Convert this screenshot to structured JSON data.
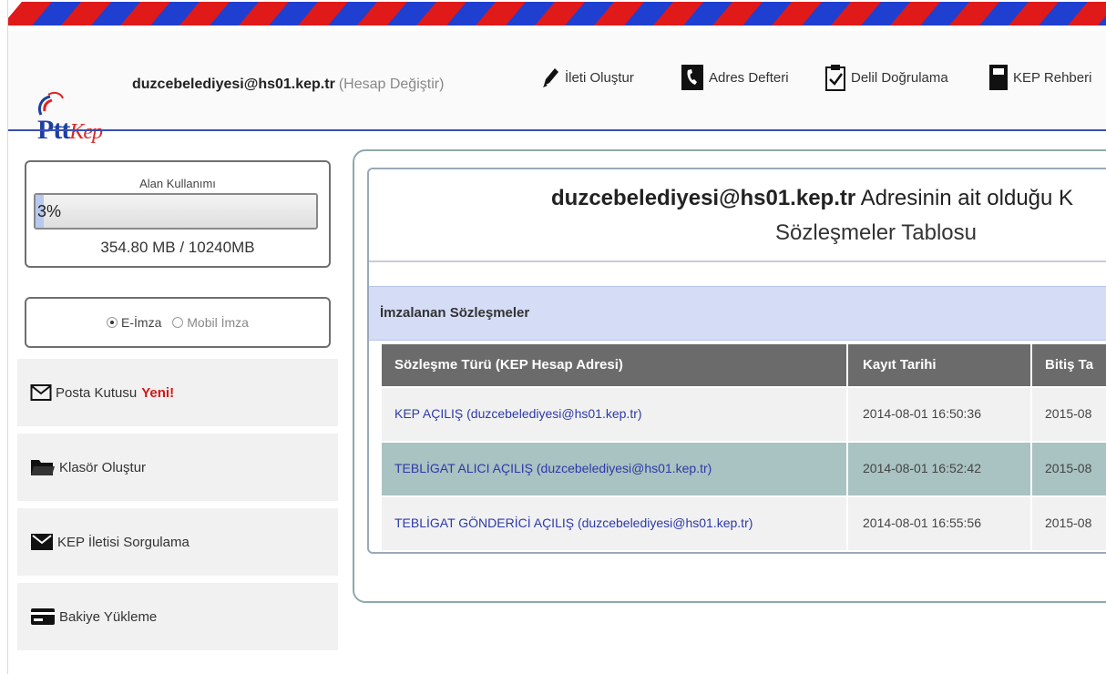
{
  "colors": {
    "stripe_red": "#e01919",
    "stripe_blue": "#1f3fd0",
    "link_blue": "#2d3aa8",
    "accent_new": "#d01818",
    "header_line": "#3a4fb4",
    "section_bg": "#d4dcf6",
    "table_head": "#6b6b6b",
    "row_alt": "#a9c2c2",
    "row_light": "#f1f1f1"
  },
  "header": {
    "logo": {
      "text_main": "Ptt",
      "text_sub": "Kep"
    },
    "account": {
      "email": "duzcebelediyesi@hs01.kep.tr",
      "change_label": "(Hesap Değiştir)"
    },
    "nav": [
      {
        "label": "İleti Oluştur",
        "icon": "pen-icon"
      },
      {
        "label": "Adres Defteri",
        "icon": "phone-book-icon"
      },
      {
        "label": "Delil Doğrulama",
        "icon": "clipboard-check-icon"
      },
      {
        "label": "KEP Rehberi",
        "icon": "book-icon"
      }
    ]
  },
  "sidebar": {
    "usage": {
      "label": "Alan Kullanımı",
      "percent_text": "3%",
      "percent": 3,
      "size_text": "354.80 MB / 10240MB"
    },
    "signature": {
      "option1": "E-İmza",
      "option2": "Mobil İmza",
      "selected": "E-İmza"
    },
    "items": [
      {
        "label": "Posta Kutusu",
        "badge": "Yeni!",
        "icon": "envelope-icon"
      },
      {
        "label": "Klasör Oluştur",
        "icon": "folder-icon"
      },
      {
        "label": "KEP İletisi Sorgulama",
        "icon": "mail-search-icon"
      },
      {
        "label": "Bakiye Yükleme",
        "icon": "credit-card-icon"
      }
    ]
  },
  "main": {
    "title_email": "duzcebelediyesi@hs01.kep.tr",
    "title_rest": "Adresinin ait olduğu K",
    "title_line2": "Sözleşmeler Tablosu",
    "section_title": "İmzalanan Sözleşmeler",
    "table": {
      "headers": [
        "Sözleşme Türü (KEP Hesap Adresi)",
        "Kayıt Tarihi",
        "Bitiş Ta"
      ],
      "rows": [
        {
          "type": "KEP AÇILIŞ (duzcebelediyesi@hs01.kep.tr)",
          "date": "2014-08-01 16:50:36",
          "end": "2015-08"
        },
        {
          "type": "TEBLİGAT ALICI AÇILIŞ (duzcebelediyesi@hs01.kep.tr)",
          "date": "2014-08-01 16:52:42",
          "end": "2015-08"
        },
        {
          "type": "TEBLİGAT GÖNDERİCİ AÇILIŞ (duzcebelediyesi@hs01.kep.tr)",
          "date": "2014-08-01 16:55:56",
          "end": "2015-08"
        }
      ]
    }
  }
}
